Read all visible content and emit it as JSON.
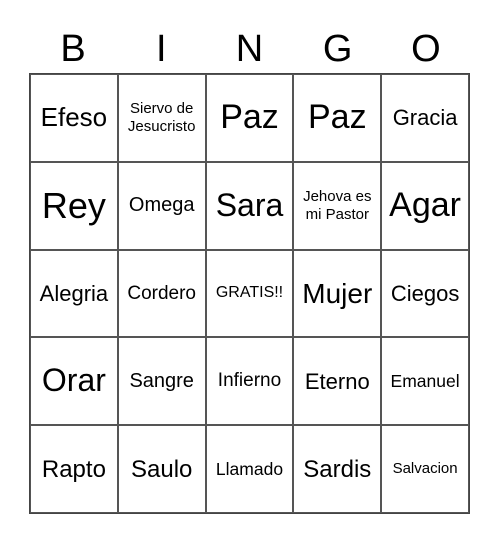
{
  "header": [
    "B",
    "I",
    "N",
    "G",
    "O"
  ],
  "cells": [
    [
      "Efeso",
      "Siervo de Jesucristo",
      "Paz",
      "Paz",
      "Gracia"
    ],
    [
      "Rey",
      "Omega",
      "Sara",
      "Jehova es mi Pastor",
      "Agar"
    ],
    [
      "Alegria",
      "Cordero",
      "GRATIS!!",
      "Mujer",
      "Ciegos"
    ],
    [
      "Orar",
      "Sangre",
      "Infierno",
      "Eterno",
      "Emanuel"
    ],
    [
      "Rapto",
      "Saulo",
      "Llamado",
      "Sardis",
      "Salvacion"
    ]
  ]
}
